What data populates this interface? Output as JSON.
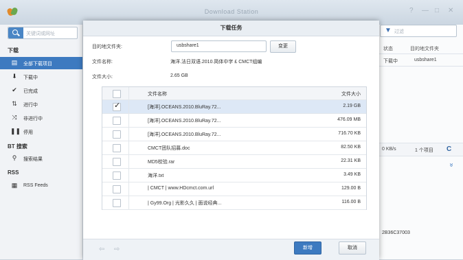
{
  "window": {
    "title": "Download Station",
    "controls": [
      "?",
      "—",
      "□",
      "✕"
    ]
  },
  "sidebar": {
    "search_placeholder": "关键词或网址",
    "section_download": "下载",
    "items": [
      {
        "label": "全部下载项目",
        "icon": "download-list-icon"
      },
      {
        "label": "下载中",
        "icon": "arrow-down-icon"
      },
      {
        "label": "已完成",
        "icon": "check-icon"
      },
      {
        "label": "进行中",
        "icon": "up-down-arrows-icon"
      },
      {
        "label": "非进行中",
        "icon": "crossed-arrows-icon"
      },
      {
        "label": "停用",
        "icon": "pause-icon"
      }
    ],
    "section_bt": "BT 搜索",
    "bt_item": {
      "label": "搜索结果",
      "icon": "search-icon"
    },
    "section_rss": "RSS",
    "rss_item": {
      "label": "RSS Feeds",
      "icon": "rss-icon"
    }
  },
  "background": {
    "filter_placeholder": "过滤",
    "col_status": "状态",
    "col_dest": "目的地文件夹",
    "row_status": "下载中",
    "row_dest": "usbshare1",
    "speed": "0 KB/s",
    "count": "1 个项目",
    "refresh": "C",
    "expand": "»",
    "id_fragment": "2B36C37003"
  },
  "dialog": {
    "title": "下载任务",
    "dest_label": "目的地文件夹:",
    "dest_value": "usbshare1",
    "change_button": "变更",
    "filename_label": "文件名称:",
    "filename_value": "海洋.法日双语.2010.简体中字 £ CMCT组编",
    "size_label": "文件大小:",
    "size_value": "2.65 GB",
    "col_filename": "文件名称",
    "col_filesize": "文件大小",
    "files": [
      {
        "name": "[海洋].OCEANS.2010.BluRay.72...",
        "size": "2.19 GB",
        "checked": true
      },
      {
        "name": "[海洋].OCEANS.2010.BluRay.72...",
        "size": "476.09 MB",
        "checked": false
      },
      {
        "name": "[海洋].OCEANS.2010.BluRay.72...",
        "size": "716.70 KB",
        "checked": false
      },
      {
        "name": "CMCT团队招募.doc",
        "size": "82.50 KB",
        "checked": false
      },
      {
        "name": "MD5校验.rar",
        "size": "22.31 KB",
        "checked": false
      },
      {
        "name": "海洋.txt",
        "size": "3.49 KB",
        "checked": false
      },
      {
        "name": "| CMCT | www.HDcmct.com.url",
        "size": "129.00 B",
        "checked": false
      },
      {
        "name": "| Gy99.Org | 光影久久 | 面说经典...",
        "size": "116.00 B",
        "checked": false
      }
    ],
    "back_arrow": "⇦",
    "forward_arrow": "⇨",
    "ok_button": "新增",
    "cancel_button": "取消"
  }
}
